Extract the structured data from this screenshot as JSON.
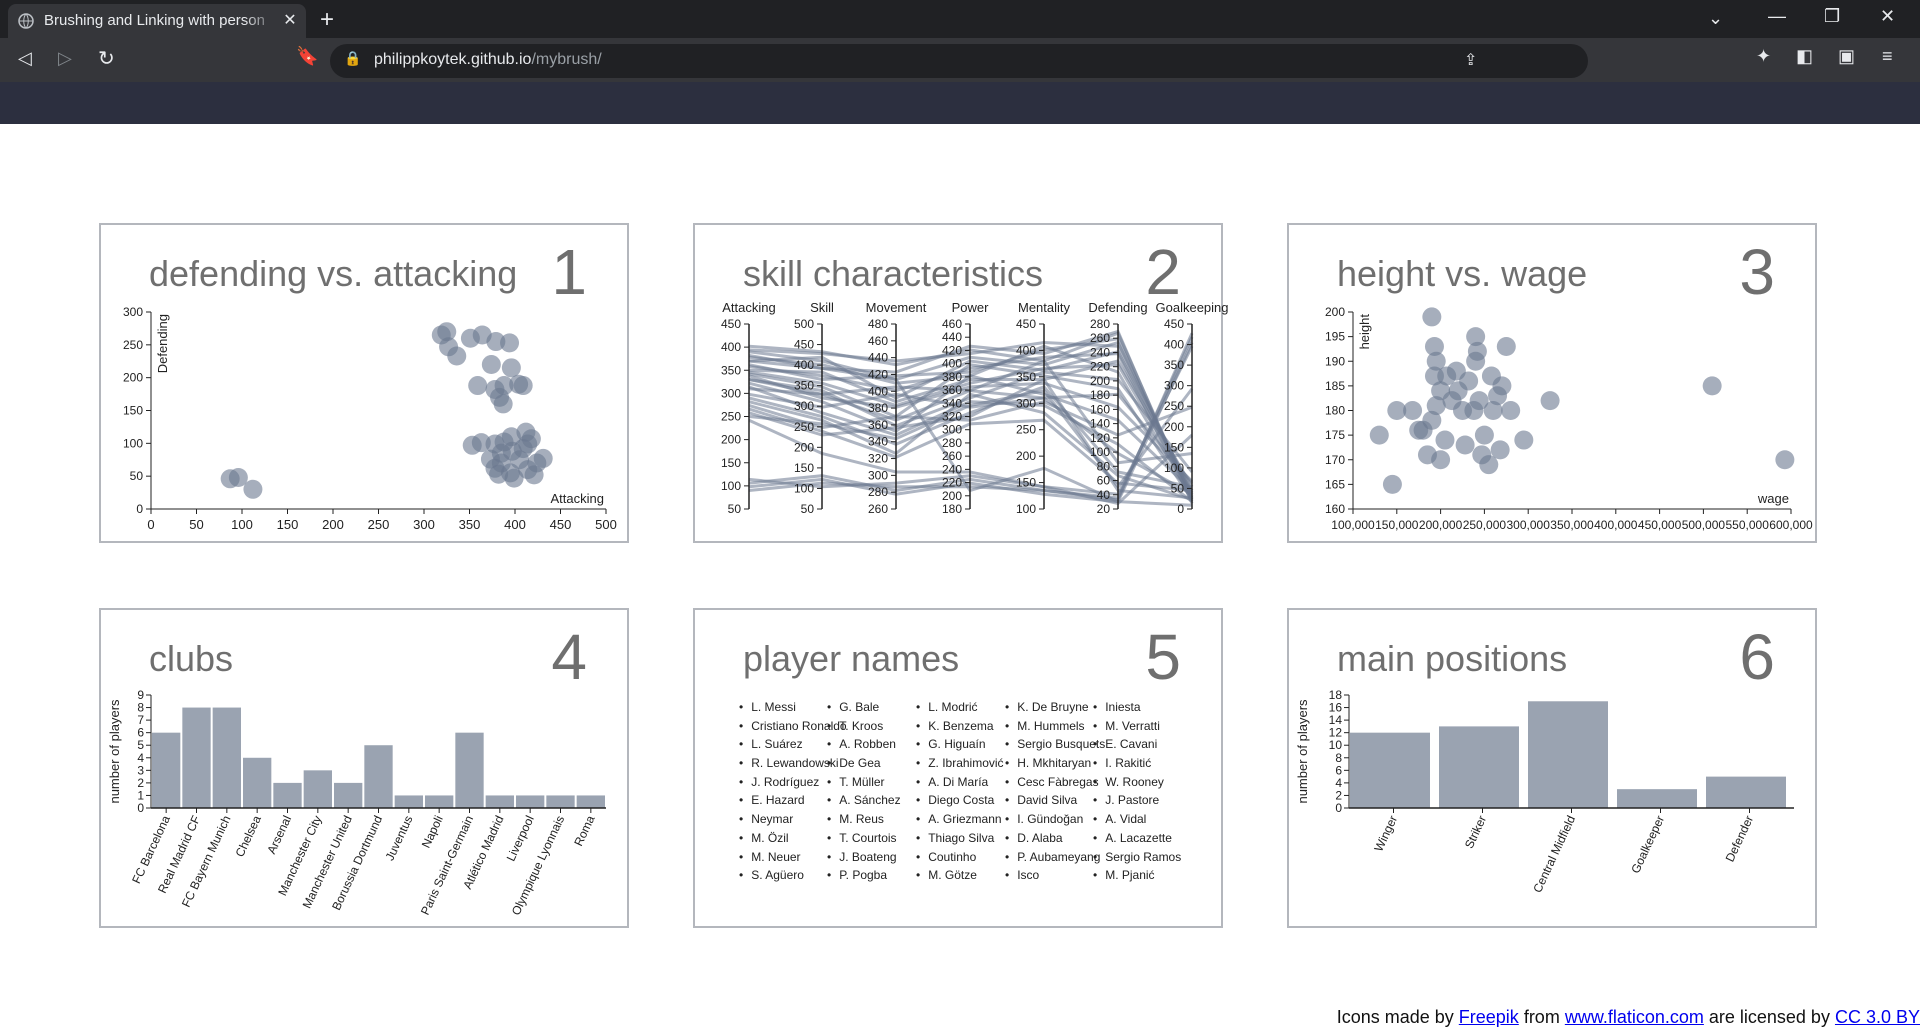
{
  "browser": {
    "tab_title": "Brushing and Linking with person",
    "url_host": "philippkoytek.github.io",
    "url_path": "/mybrush/",
    "new_tab_icon": "plus-icon",
    "close_tab_icon": "close-icon"
  },
  "panels": {
    "p1": {
      "title": "defending vs. attacking",
      "num": "1"
    },
    "p2": {
      "title": "skill characteristics",
      "num": "2"
    },
    "p3": {
      "title": "height vs. wage",
      "num": "3"
    },
    "p4": {
      "title": "clubs",
      "num": "4"
    },
    "p5": {
      "title": "player names",
      "num": "5"
    },
    "p6": {
      "title": "main positions",
      "num": "6"
    }
  },
  "chart_data": [
    {
      "id": "scatter1",
      "type": "scatter",
      "xlabel": "Attacking",
      "ylabel": "Defending",
      "xlim": [
        0,
        500
      ],
      "ylim": [
        0,
        300
      ],
      "xticks": [
        0,
        50,
        100,
        150,
        200,
        250,
        300,
        350,
        400,
        450,
        500
      ],
      "yticks": [
        0,
        50,
        100,
        150,
        200,
        250,
        300
      ],
      "color": "#6b7890",
      "points": [
        [
          87,
          46
        ],
        [
          96,
          48
        ],
        [
          112,
          30
        ],
        [
          319,
          265
        ],
        [
          325,
          270
        ],
        [
          327,
          247
        ],
        [
          336,
          233
        ],
        [
          351,
          260
        ],
        [
          364,
          265
        ],
        [
          359,
          188
        ],
        [
          374,
          220
        ],
        [
          379,
          255
        ],
        [
          394,
          253
        ],
        [
          388,
          188
        ],
        [
          378,
          182
        ],
        [
          396,
          215
        ],
        [
          383,
          170
        ],
        [
          387,
          160
        ],
        [
          404,
          190
        ],
        [
          409,
          188
        ],
        [
          353,
          97
        ],
        [
          363,
          101
        ],
        [
          378,
          99
        ],
        [
          388,
          102
        ],
        [
          396,
          110
        ],
        [
          412,
          117
        ],
        [
          418,
          107
        ],
        [
          431,
          77
        ],
        [
          373,
          76
        ],
        [
          378,
          62
        ],
        [
          385,
          70
        ],
        [
          395,
          55
        ],
        [
          399,
          47
        ],
        [
          405,
          75
        ],
        [
          409,
          92
        ],
        [
          414,
          60
        ],
        [
          421,
          52
        ],
        [
          424,
          70
        ],
        [
          414,
          99
        ],
        [
          397,
          88
        ],
        [
          385,
          85
        ],
        [
          382,
          53
        ]
      ]
    },
    {
      "id": "parallel2",
      "type": "line",
      "axes": [
        {
          "name": "Attacking",
          "ticks": [
            "450",
            "400",
            "350",
            "300",
            "250",
            "200",
            "150",
            "100",
            "50"
          ]
        },
        {
          "name": "Skill",
          "ticks": [
            "500",
            "450",
            "400",
            "350",
            "300",
            "250",
            "200",
            "150",
            "100",
            "50"
          ]
        },
        {
          "name": "Movement",
          "ticks": [
            "480",
            "460",
            "440",
            "420",
            "400",
            "380",
            "360",
            "340",
            "320",
            "300",
            "280",
            "260"
          ]
        },
        {
          "name": "Power",
          "ticks": [
            "460",
            "440",
            "420",
            "400",
            "380",
            "360",
            "340",
            "320",
            "300",
            "280",
            "260",
            "240",
            "220",
            "200",
            "180"
          ]
        },
        {
          "name": "Mentality",
          "ticks": [
            "450",
            "400",
            "350",
            "300",
            "250",
            "200",
            "150",
            "100"
          ]
        },
        {
          "name": "Defending",
          "ticks": [
            "280",
            "260",
            "240",
            "220",
            "200",
            "180",
            "160",
            "140",
            "120",
            "100",
            "80",
            "60",
            "40",
            "20"
          ]
        },
        {
          "name": "Goalkeeping",
          "ticks": [
            "450",
            "400",
            "350",
            "300",
            "250",
            "200",
            "150",
            "100",
            "50",
            "0"
          ]
        }
      ],
      "color": "#6b7890",
      "lines": [
        [
          0.88,
          0.85,
          0.78,
          0.86,
          0.8,
          0.95,
          0.05
        ],
        [
          0.85,
          0.8,
          0.7,
          0.82,
          0.78,
          0.9,
          0.08
        ],
        [
          0.8,
          0.82,
          0.6,
          0.8,
          0.75,
          0.85,
          0.1
        ],
        [
          0.78,
          0.7,
          0.72,
          0.74,
          0.86,
          0.92,
          0.06
        ],
        [
          0.75,
          0.74,
          0.58,
          0.7,
          0.7,
          0.8,
          0.12
        ],
        [
          0.73,
          0.66,
          0.5,
          0.78,
          0.72,
          0.65,
          0.05
        ],
        [
          0.72,
          0.6,
          0.55,
          0.66,
          0.68,
          0.55,
          0.15
        ],
        [
          0.7,
          0.64,
          0.45,
          0.6,
          0.74,
          0.7,
          0.2
        ],
        [
          0.68,
          0.58,
          0.42,
          0.72,
          0.62,
          0.48,
          0.1
        ],
        [
          0.66,
          0.52,
          0.4,
          0.58,
          0.56,
          0.35,
          0.04
        ],
        [
          0.65,
          0.62,
          0.66,
          0.64,
          0.8,
          0.25,
          0.3
        ],
        [
          0.62,
          0.55,
          0.62,
          0.55,
          0.6,
          0.3,
          0.08
        ],
        [
          0.6,
          0.5,
          0.35,
          0.52,
          0.66,
          0.2,
          0.12
        ],
        [
          0.58,
          0.48,
          0.3,
          0.62,
          0.52,
          0.18,
          0.05
        ],
        [
          0.56,
          0.44,
          0.5,
          0.48,
          0.58,
          0.4,
          0.55
        ],
        [
          0.54,
          0.42,
          0.28,
          0.46,
          0.48,
          0.14,
          0.1
        ],
        [
          0.52,
          0.4,
          0.44,
          0.5,
          0.7,
          0.1,
          0.06
        ],
        [
          0.5,
          0.46,
          0.38,
          0.56,
          0.64,
          0.12,
          0.65
        ],
        [
          0.83,
          0.76,
          0.74,
          0.88,
          0.84,
          0.96,
          0.03
        ],
        [
          0.86,
          0.84,
          0.8,
          0.84,
          0.9,
          0.88,
          0.07
        ],
        [
          0.77,
          0.72,
          0.64,
          0.76,
          0.82,
          0.84,
          0.04
        ],
        [
          0.74,
          0.68,
          0.56,
          0.68,
          0.76,
          0.78,
          0.09
        ],
        [
          0.7,
          0.62,
          0.48,
          0.64,
          0.6,
          0.62,
          0.14
        ],
        [
          0.82,
          0.78,
          0.68,
          0.72,
          0.88,
          0.74,
          0.06
        ],
        [
          0.14,
          0.18,
          0.1,
          0.16,
          0.1,
          0.05,
          0.95
        ],
        [
          0.12,
          0.16,
          0.08,
          0.14,
          0.08,
          0.04,
          0.9
        ],
        [
          0.1,
          0.14,
          0.12,
          0.12,
          0.1,
          0.06,
          0.93
        ],
        [
          0.16,
          0.12,
          0.14,
          0.18,
          0.12,
          0.08,
          0.88
        ],
        [
          0.8,
          0.76,
          0.7,
          0.1,
          0.22,
          0.04,
          0.02
        ],
        [
          0.48,
          0.3,
          0.2,
          0.2,
          0.12,
          0.03,
          0.4
        ]
      ]
    },
    {
      "id": "scatter3",
      "type": "scatter",
      "xlabel": "wage",
      "ylabel": "height",
      "xlim": [
        100000,
        600000
      ],
      "ylim": [
        160,
        200
      ],
      "xticks": [
        100000,
        150000,
        200000,
        250000,
        300000,
        350000,
        400000,
        450000,
        500000,
        550000,
        600000
      ],
      "xtick_labels": [
        "100,000",
        "150,000",
        "200,000",
        "250,000",
        "300,000",
        "350,000",
        "400,000",
        "450,000",
        "500,000",
        "550,000",
        "600,000"
      ],
      "yticks": [
        160,
        165,
        170,
        175,
        180,
        185,
        190,
        195,
        200
      ],
      "color": "#6b7890",
      "points": [
        [
          130000,
          175
        ],
        [
          145000,
          165
        ],
        [
          150000,
          180
        ],
        [
          168000,
          180
        ],
        [
          180000,
          176
        ],
        [
          185000,
          171
        ],
        [
          190000,
          178
        ],
        [
          190000,
          199
        ],
        [
          193000,
          193
        ],
        [
          193000,
          187
        ],
        [
          195000,
          190
        ],
        [
          200000,
          184
        ],
        [
          195000,
          181
        ],
        [
          200000,
          170
        ],
        [
          205000,
          174
        ],
        [
          207000,
          187
        ],
        [
          213000,
          182
        ],
        [
          218000,
          188
        ],
        [
          220000,
          184
        ],
        [
          225000,
          180
        ],
        [
          228000,
          173
        ],
        [
          232000,
          186
        ],
        [
          238000,
          180
        ],
        [
          240000,
          195
        ],
        [
          242000,
          192
        ],
        [
          240000,
          190
        ],
        [
          244000,
          182
        ],
        [
          247000,
          171
        ],
        [
          250000,
          175
        ],
        [
          255000,
          169
        ],
        [
          258000,
          187
        ],
        [
          260000,
          180
        ],
        [
          265000,
          183
        ],
        [
          268000,
          172
        ],
        [
          270000,
          185
        ],
        [
          275000,
          193
        ],
        [
          280000,
          180
        ],
        [
          295000,
          174
        ],
        [
          325000,
          182
        ],
        [
          510000,
          185
        ],
        [
          593000,
          170
        ],
        [
          175000,
          176
        ]
      ]
    },
    {
      "id": "bar4",
      "type": "bar",
      "ylabel": "number of players",
      "ylim": [
        0,
        9
      ],
      "yticks": [
        0,
        1,
        2,
        3,
        4,
        5,
        6,
        7,
        8,
        9
      ],
      "color": "#9aa3b1",
      "categories": [
        "FC Barcelona",
        "Real Madrid CF",
        "FC Bayern Munich",
        "Chelsea",
        "Arsenal",
        "Manchester City",
        "Manchester United",
        "Borussia Dortmund",
        "Juventus",
        "Napoli",
        "Paris Saint-Germain",
        "Atlético Madrid",
        "Liverpool",
        "Olympique Lyonnais",
        "Roma"
      ],
      "values": [
        6,
        8,
        8,
        4,
        2,
        3,
        2,
        5,
        1,
        1,
        6,
        1,
        1,
        1,
        1
      ]
    },
    {
      "id": "bar6",
      "type": "bar",
      "ylabel": "number of players",
      "ylim": [
        0,
        18
      ],
      "yticks": [
        0,
        2,
        4,
        6,
        8,
        10,
        12,
        14,
        16,
        18
      ],
      "color": "#9aa3b1",
      "categories": [
        "Winger",
        "Striker",
        "Central Midfield",
        "Goalkeeper",
        "Defender"
      ],
      "values": [
        12,
        13,
        17,
        3,
        5
      ]
    }
  ],
  "names": [
    [
      "L. Messi",
      "Cristiano Ronaldo",
      "L. Suárez",
      "R. Lewandowski",
      "J. Rodríguez",
      "E. Hazard",
      "Neymar",
      "M. Özil",
      "M. Neuer",
      "S. Agüero"
    ],
    [
      "G. Bale",
      "T. Kroos",
      "A. Robben",
      "De Gea",
      "T. Müller",
      "A. Sánchez",
      "M. Reus",
      "T. Courtois",
      "J. Boateng",
      "P. Pogba"
    ],
    [
      "L. Modrić",
      "K. Benzema",
      "G. Higuaín",
      "Z. Ibrahimović",
      "A. Di María",
      "Diego Costa",
      "A. Griezmann",
      "Thiago Silva",
      "Coutinho",
      "M. Götze"
    ],
    [
      "K. De Bruyne",
      "M. Hummels",
      "Sergio Busquets",
      "H. Mkhitaryan",
      "Cesc Fàbregas",
      "David Silva",
      "I. Gündoğan",
      "D. Alaba",
      "P. Aubameyang",
      "Isco"
    ],
    [
      "Iniesta",
      "M. Verratti",
      "E. Cavani",
      "I. Rakitić",
      "W. Rooney",
      "J. Pastore",
      "A. Vidal",
      "A. Lacazette",
      "Sergio Ramos",
      "M. Pjanić"
    ]
  ],
  "footer": {
    "prefix": "Icons made by ",
    "link1": "Freepik",
    "middle1": " from ",
    "link2": "www.flaticon.com",
    "middle2": " are licensed by ",
    "link3": "CC 3.0 BY"
  }
}
